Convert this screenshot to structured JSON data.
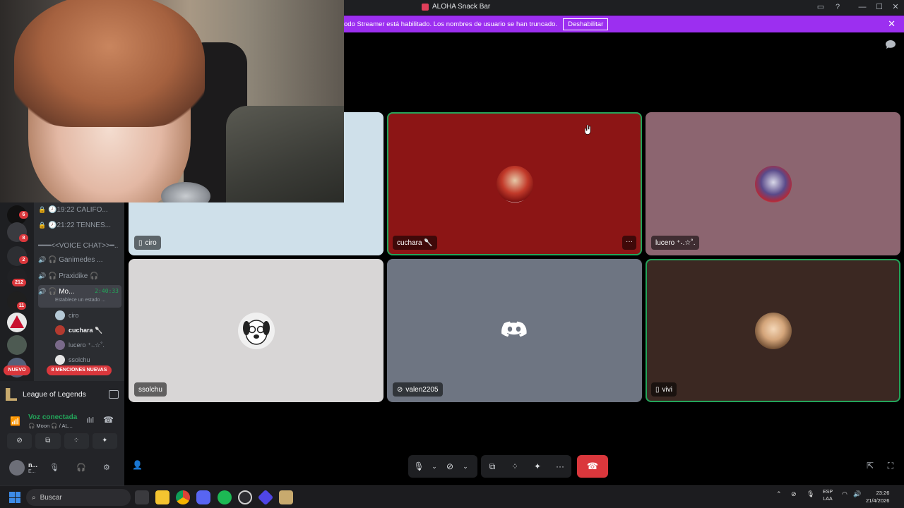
{
  "window": {
    "title": "ALOHA Snack Bar",
    "controls": [
      "▭",
      "?",
      "—",
      "☐",
      "✕"
    ]
  },
  "banner": {
    "message": "odo Streamer está habilitado. Los nombres de usuario se han truncado.",
    "disable_label": "Deshabilitar",
    "close": "✕"
  },
  "colors": {
    "banner_bg": "#9c2ff0",
    "speaking_outline": "#23a55a",
    "hangup": "#da373c"
  },
  "sidebar": {
    "guild_badges": [
      "6",
      "8",
      "2",
      "212",
      "11"
    ],
    "new_label": "NUEVO",
    "channels": [
      {
        "icon": "lock-icon",
        "name": "🕗19:22 CALIFO..."
      },
      {
        "icon": "lock-icon",
        "name": "🕗21:22 TENNES..."
      },
      {
        "icon": "",
        "name": "━━━<<VOICE CHAT>>━.."
      },
      {
        "icon": "speaker-icon",
        "name": "🎧 Ganimedes ..."
      },
      {
        "icon": "speaker-icon",
        "name": "🎧 Praxidike 🎧"
      }
    ],
    "active_channel": {
      "name": "🎧 Mo...",
      "timer": "2:40:33",
      "status": "Establece un estado ..."
    },
    "voice_users": [
      "ciro",
      "cuchara 🥄",
      "lucero ⁺˖.☆˚.",
      "ssolchu"
    ],
    "mentions_label": "8 MENCIONES NUEVAS"
  },
  "activity": {
    "game": "League of Legends"
  },
  "voice": {
    "status": "Voz conectada",
    "channel": "🎧 Moon 🎧 / AL..."
  },
  "user": {
    "name": "n...",
    "status": "E..."
  },
  "tiles": [
    {
      "name": "ciro",
      "icon": "phone-icon",
      "bg": "#cfe0ea"
    },
    {
      "name": "cuchara 🥄",
      "icon": "",
      "bg": "#8c1515"
    },
    {
      "name": "lucero ⁺˖.☆˚.",
      "icon": "",
      "bg": "#8c6570"
    },
    {
      "name": "ssolchu",
      "icon": "",
      "bg": "#d8d6d6"
    },
    {
      "name": "valen2205",
      "icon": "mic-muted-icon",
      "bg": "#6e7582"
    },
    {
      "name": "vivi",
      "icon": "phone-icon",
      "bg": "#3b2822"
    }
  ],
  "tile_more": "···",
  "taskbar": {
    "search_placeholder": "Buscar",
    "lang_top": "ESP",
    "lang_bottom": "LAA",
    "time": "23:26",
    "date": "21/4/2026"
  }
}
